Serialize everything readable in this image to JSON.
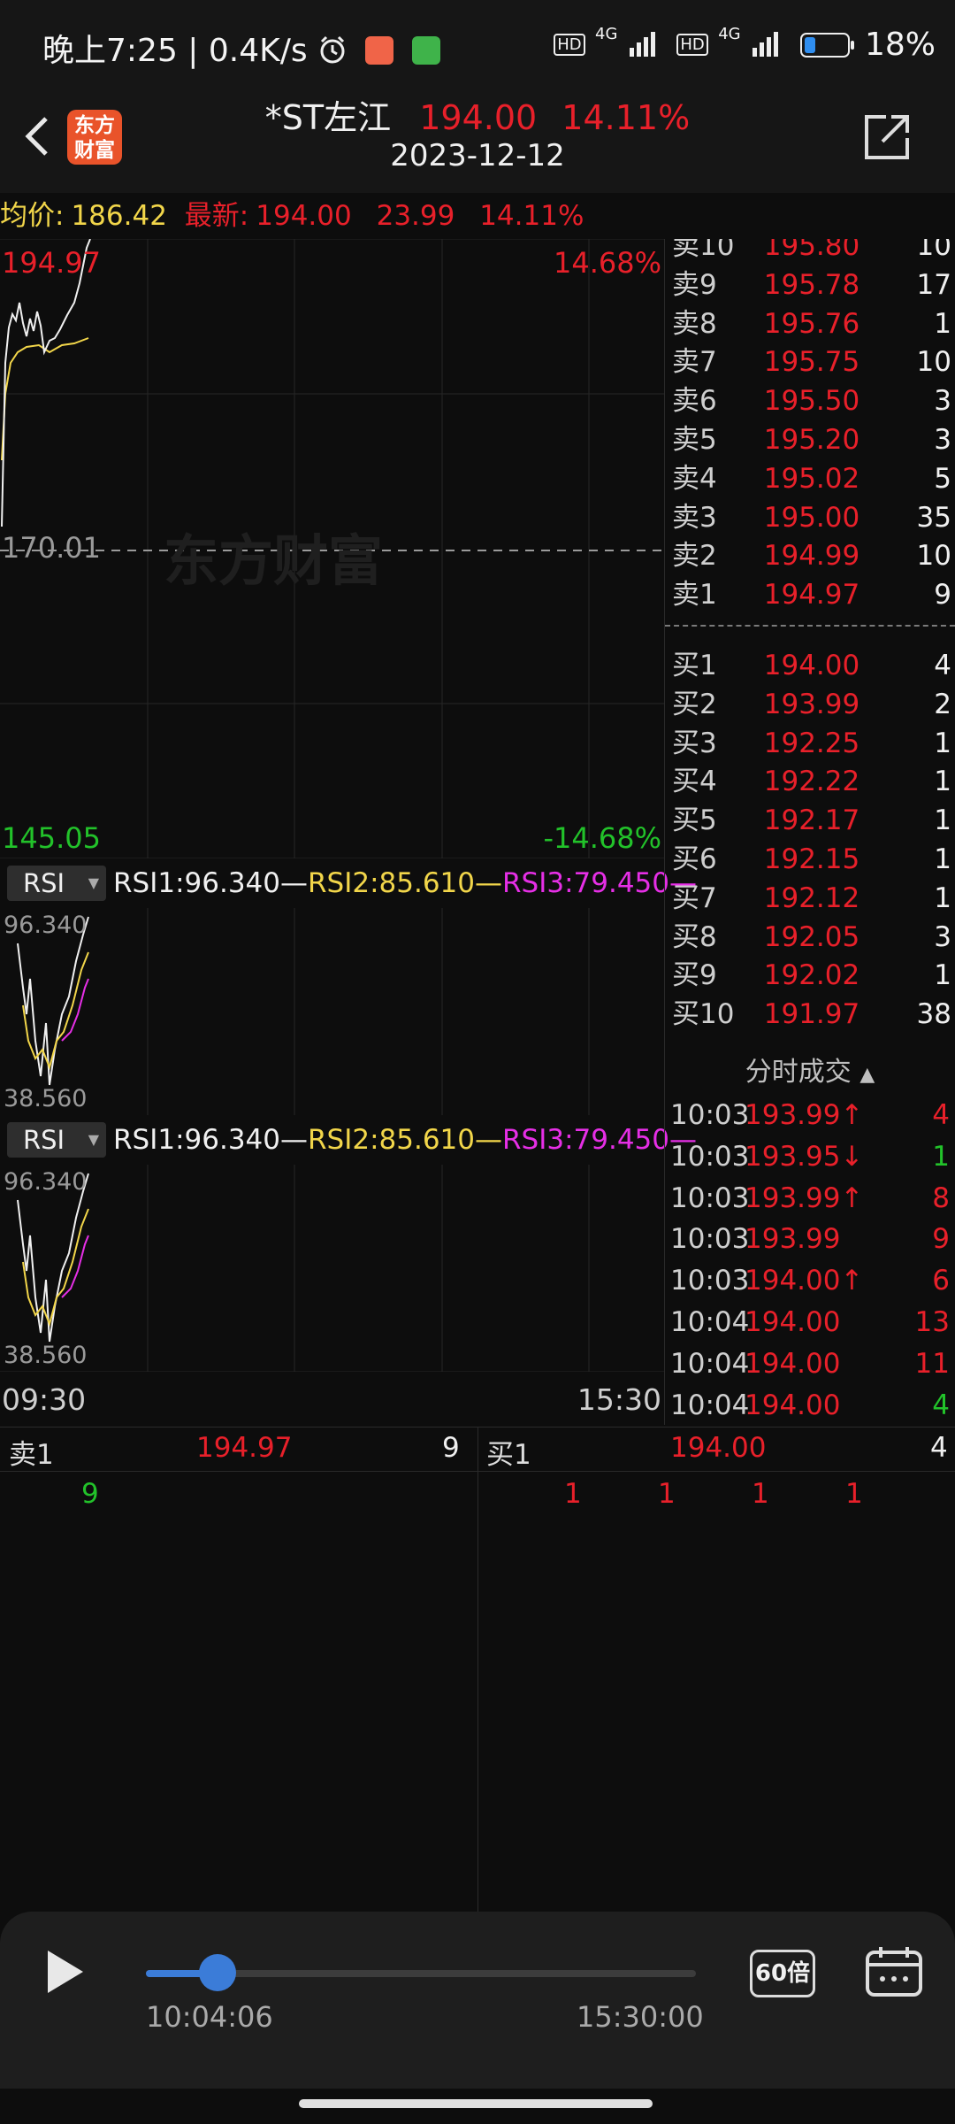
{
  "status_bar": {
    "time": "晚上7:25",
    "net_speed": "0.4K/s",
    "alarm_icon": "alarm-icon",
    "battery": "18%",
    "net1": "4G",
    "net2": "4G",
    "hd": "HD"
  },
  "header": {
    "stock_name": "*ST左江",
    "price": "194.00",
    "change_pct": "14.11%",
    "date": "2023-12-12",
    "logo_line1": "东方",
    "logo_line2": "财富"
  },
  "info_row": {
    "avg_label": "均价:",
    "avg_value": "186.42",
    "latest_label": "最新:",
    "latest_value": "194.00",
    "change": "23.99",
    "change_pct": "14.11%"
  },
  "price_chart": {
    "high_price": "194.97",
    "high_pct": "14.68%",
    "prev_close": "170.01",
    "low_price": "145.05",
    "low_pct": "-14.68%",
    "watermark": "东方财富",
    "colors": {
      "price_line": "#f0f0f0",
      "avg_line": "#f2d64a",
      "up": "#e8202a",
      "down": "#22c22a"
    }
  },
  "rsi_panels": [
    {
      "name": "RSI",
      "rsi1": "RSI1:96.340—",
      "rsi2": "RSI2:85.610—",
      "rsi3": "RSI3:79.450—",
      "top": "96.340",
      "bottom": "38.560"
    },
    {
      "name": "RSI",
      "rsi1": "RSI1:96.340—",
      "rsi2": "RSI2:85.610—",
      "rsi3": "RSI3:79.450—",
      "top": "96.340",
      "bottom": "38.560"
    }
  ],
  "time_axis": {
    "start": "09:30",
    "end": "15:30"
  },
  "order_book": {
    "asks": [
      {
        "label": "卖10",
        "price": "195.80",
        "vol": "10"
      },
      {
        "label": "卖9",
        "price": "195.78",
        "vol": "17"
      },
      {
        "label": "卖8",
        "price": "195.76",
        "vol": "1"
      },
      {
        "label": "卖7",
        "price": "195.75",
        "vol": "10"
      },
      {
        "label": "卖6",
        "price": "195.50",
        "vol": "3"
      },
      {
        "label": "卖5",
        "price": "195.20",
        "vol": "3"
      },
      {
        "label": "卖4",
        "price": "195.02",
        "vol": "5"
      },
      {
        "label": "卖3",
        "price": "195.00",
        "vol": "35"
      },
      {
        "label": "卖2",
        "price": "194.99",
        "vol": "10"
      },
      {
        "label": "卖1",
        "price": "194.97",
        "vol": "9"
      }
    ],
    "bids": [
      {
        "label": "买1",
        "price": "194.00",
        "vol": "4"
      },
      {
        "label": "买2",
        "price": "193.99",
        "vol": "2"
      },
      {
        "label": "买3",
        "price": "192.25",
        "vol": "1"
      },
      {
        "label": "买4",
        "price": "192.22",
        "vol": "1"
      },
      {
        "label": "买5",
        "price": "192.17",
        "vol": "1"
      },
      {
        "label": "买6",
        "price": "192.15",
        "vol": "1"
      },
      {
        "label": "买7",
        "price": "192.12",
        "vol": "1"
      },
      {
        "label": "买8",
        "price": "192.05",
        "vol": "3"
      },
      {
        "label": "买9",
        "price": "192.02",
        "vol": "1"
      },
      {
        "label": "买10",
        "price": "191.97",
        "vol": "38"
      }
    ]
  },
  "trades": {
    "title": "分时成交",
    "sort_icon": "triangle-up-icon",
    "rows": [
      {
        "time": "10:03",
        "price": "193.99↑",
        "vol": "4",
        "price_color": "#e8202a",
        "vol_color": "#e8202a"
      },
      {
        "time": "10:03",
        "price": "193.95↓",
        "vol": "1",
        "price_color": "#e8202a",
        "vol_color": "#22c22a"
      },
      {
        "time": "10:03",
        "price": "193.99↑",
        "vol": "8",
        "price_color": "#e8202a",
        "vol_color": "#e8202a"
      },
      {
        "time": "10:03",
        "price": "193.99",
        "vol": "9",
        "price_color": "#e8202a",
        "vol_color": "#e8202a"
      },
      {
        "time": "10:03",
        "price": "194.00↑",
        "vol": "6",
        "price_color": "#e8202a",
        "vol_color": "#e8202a"
      },
      {
        "time": "10:04",
        "price": "194.00",
        "vol": "13",
        "price_color": "#e8202a",
        "vol_color": "#e8202a"
      },
      {
        "time": "10:04",
        "price": "194.00",
        "vol": "11",
        "price_color": "#e8202a",
        "vol_color": "#e8202a"
      },
      {
        "time": "10:04",
        "price": "194.00",
        "vol": "4",
        "price_color": "#e8202a",
        "vol_color": "#22c22a"
      }
    ]
  },
  "depth": {
    "ask_label": "卖1",
    "ask_price": "194.97",
    "ask_vol": "9",
    "ask_orders": [
      "9"
    ],
    "bid_label": "买1",
    "bid_price": "194.00",
    "bid_vol": "4",
    "bid_orders": [
      "1",
      "1",
      "1",
      "1"
    ]
  },
  "playback": {
    "current_time": "10:04:06",
    "end_time": "15:30:00",
    "speed": "60倍",
    "progress": 0.13
  }
}
